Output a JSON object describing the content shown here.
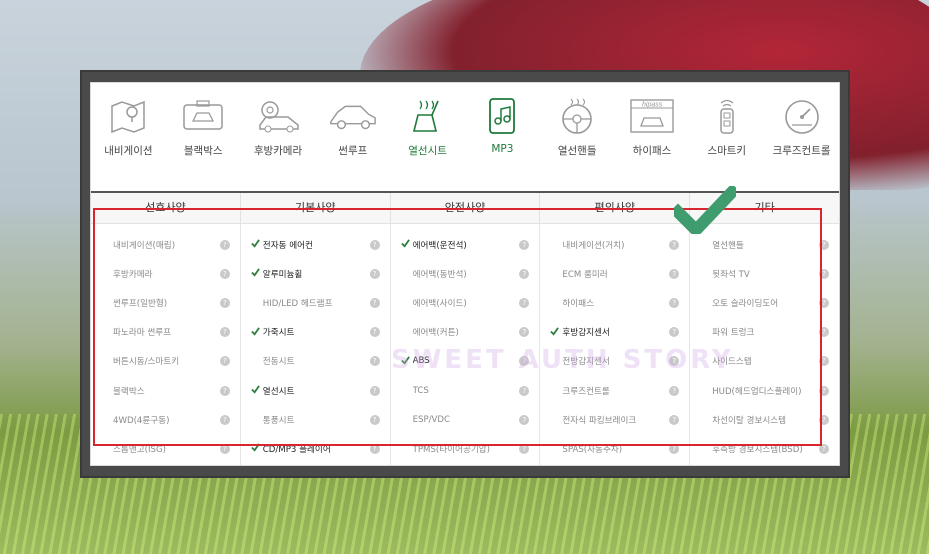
{
  "icon_bar": [
    {
      "label": "내비게이션",
      "icon": "navigation-map-icon",
      "active": false
    },
    {
      "label": "블랙박스",
      "icon": "dashcam-icon",
      "active": false
    },
    {
      "label": "후방카메라",
      "icon": "rear-camera-icon",
      "active": false
    },
    {
      "label": "썬루프",
      "icon": "sunroof-car-icon",
      "active": false
    },
    {
      "label": "열선시트",
      "icon": "heated-seat-icon",
      "active": true
    },
    {
      "label": "MP3",
      "icon": "mp3-phone-icon",
      "active": true
    },
    {
      "label": "열선핸들",
      "icon": "heated-steering-icon",
      "active": false
    },
    {
      "label": "하이패스",
      "icon": "hipass-icon",
      "active": false,
      "sublabel": "hipass"
    },
    {
      "label": "스마트키",
      "icon": "smart-key-icon",
      "active": false
    },
    {
      "label": "크루즈컨트롤",
      "icon": "cruise-control-icon",
      "active": false
    }
  ],
  "columns": [
    {
      "header": "선호사양",
      "items": [
        {
          "label": "내비게이션(매립)",
          "checked": false
        },
        {
          "label": "후방카메라",
          "checked": false
        },
        {
          "label": "썬루프(일반형)",
          "checked": false
        },
        {
          "label": "파노라마 썬루프",
          "checked": false
        },
        {
          "label": "버튼시동/스마트키",
          "checked": false
        },
        {
          "label": "블랙박스",
          "checked": false
        },
        {
          "label": "4WD(4륜구동)",
          "checked": false
        },
        {
          "label": "스톱앤고(ISG)",
          "checked": false
        }
      ]
    },
    {
      "header": "기본사양",
      "items": [
        {
          "label": "전자동 에어컨",
          "checked": true
        },
        {
          "label": "알루미늄휠",
          "checked": true
        },
        {
          "label": "HID/LED 헤드램프",
          "checked": false
        },
        {
          "label": "가죽시트",
          "checked": true
        },
        {
          "label": "전동시트",
          "checked": false
        },
        {
          "label": "열선시트",
          "checked": true
        },
        {
          "label": "통풍시트",
          "checked": false
        },
        {
          "label": "CD/MP3 플레이어",
          "checked": true
        }
      ]
    },
    {
      "header": "안전사양",
      "items": [
        {
          "label": "에어백(운전석)",
          "checked": true
        },
        {
          "label": "에어백(동반석)",
          "checked": false
        },
        {
          "label": "에어백(사이드)",
          "checked": false
        },
        {
          "label": "에어백(커튼)",
          "checked": false
        },
        {
          "label": "ABS",
          "checked": true
        },
        {
          "label": "TCS",
          "checked": false
        },
        {
          "label": "ESP/VDC",
          "checked": false
        },
        {
          "label": "TPMS(타이어공기압)",
          "checked": false
        }
      ]
    },
    {
      "header": "편의사양",
      "items": [
        {
          "label": "내비게이션(거치)",
          "checked": false
        },
        {
          "label": "ECM 룸미러",
          "checked": false
        },
        {
          "label": "하이패스",
          "checked": false
        },
        {
          "label": "후방감지센서",
          "checked": true
        },
        {
          "label": "전방감지센서",
          "checked": false
        },
        {
          "label": "크루즈컨트롤",
          "checked": false
        },
        {
          "label": "전자식 파킹브레이크",
          "checked": false
        },
        {
          "label": "SPAS(자동주차)",
          "checked": false
        }
      ]
    },
    {
      "header": "기타",
      "items": [
        {
          "label": "열선핸들",
          "checked": false
        },
        {
          "label": "뒷좌석 TV",
          "checked": false
        },
        {
          "label": "오토 슬라이딩도어",
          "checked": false
        },
        {
          "label": "파워 트렁크",
          "checked": false
        },
        {
          "label": "사이드스텝",
          "checked": false
        },
        {
          "label": "HUD(헤드업디스플레이)",
          "checked": false
        },
        {
          "label": "차선이탈 경보시스템",
          "checked": false
        },
        {
          "label": "후측방 경보시스템(BSD)",
          "checked": false
        }
      ]
    }
  ],
  "help_glyph": "?",
  "watermark": "SWEET AUTH STORY",
  "colors": {
    "check": "#2e7d3f",
    "highlight": "#1e7a3a",
    "border_red": "#d8262f",
    "big_check": "#3f9c6e"
  }
}
